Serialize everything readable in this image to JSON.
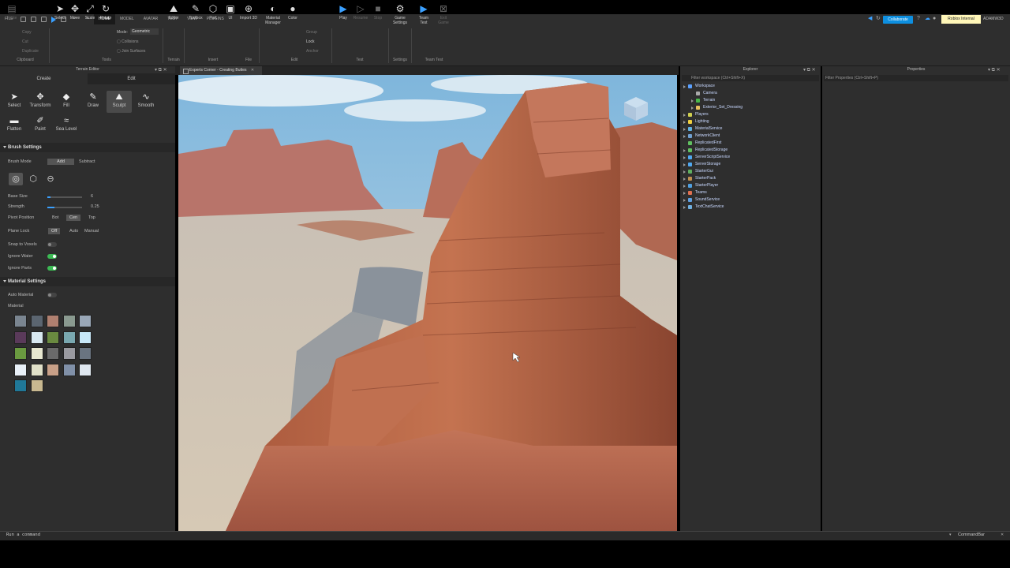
{
  "menubar": {
    "file": "FILE",
    "tabs": [
      "HOME",
      "MODEL",
      "AVATAR",
      "TEST",
      "VIEW",
      "PLUGINS"
    ],
    "active_tab": "HOME",
    "collaborate": "Collaborate",
    "roblox_internal": "Roblox Internal",
    "username": "ADAMW3D"
  },
  "ribbon": {
    "clipboard": {
      "paste": "Paste",
      "copy": "Copy",
      "cut": "Cut",
      "duplicate": "Duplicate",
      "group": "Clipboard"
    },
    "tools": {
      "select": "Select",
      "move": "Move",
      "scale": "Scale",
      "rotate": "Rotate",
      "mode_label": "Mode:",
      "mode_value": "Geometric",
      "collisions": "Collisions",
      "join_surfaces": "Join Surfaces",
      "group": "Tools"
    },
    "terrain": {
      "editor": "Editor",
      "group": "Terrain"
    },
    "insert": {
      "toolbox": "Toolbox",
      "part": "Part",
      "ui": "UI",
      "group": "Insert"
    },
    "file": {
      "import3d": "Import 3D",
      "group": "File"
    },
    "edit": {
      "material_manager": "Material Manager",
      "color": "Color",
      "group_btn": "Group",
      "lock": "Lock",
      "anchor": "Anchor",
      "group": "Edit"
    },
    "test": {
      "play": "Play",
      "resume": "Resume",
      "stop": "Stop",
      "group": "Test"
    },
    "settings": {
      "game_settings": "Game Settings",
      "group": "Settings"
    },
    "team_test": {
      "team_test": "Team Test",
      "exit_game": "Exit Game",
      "group": "Team Test"
    }
  },
  "terrain_editor": {
    "title": "Terrain Editor",
    "tabs": [
      "Create",
      "Edit"
    ],
    "tools": [
      {
        "label": "Select",
        "icon": "arrow-icon"
      },
      {
        "label": "Transform",
        "icon": "move-icon"
      },
      {
        "label": "Fill",
        "icon": "bucket-icon"
      },
      {
        "label": "Draw",
        "icon": "draw-icon"
      },
      {
        "label": "Sculpt",
        "icon": "sculpt-icon"
      },
      {
        "label": "Smooth",
        "icon": "smooth-icon"
      },
      {
        "label": "Flatten",
        "icon": "flatten-icon"
      },
      {
        "label": "Paint",
        "icon": "paint-icon"
      },
      {
        "label": "Sea Level",
        "icon": "sea-level-icon"
      }
    ],
    "selected_tool": "Sculpt",
    "brush_settings": {
      "title": "Brush Settings",
      "brush_mode": "Brush Mode",
      "add": "Add",
      "subtract": "Subtract",
      "base_size_label": "Base Size",
      "base_size_value": "6",
      "strength_label": "Strength",
      "strength_value": "0.25",
      "pivot_label": "Pivot Position",
      "pivot_options": [
        "Bot",
        "Cen",
        "Top"
      ],
      "plane_lock_label": "Plane Lock",
      "plane_lock_options": [
        "Off",
        "Auto",
        "Manual"
      ],
      "snap_label": "Snap to Voxels",
      "ignore_water_label": "Ignore Water",
      "ignore_parts_label": "Ignore Parts"
    },
    "material_settings": {
      "title": "Material Settings",
      "auto_material": "Auto Material",
      "material_label": "Material",
      "swatches": [
        "#7a8590",
        "#5b6570",
        "#b08070",
        "#8a9a90",
        "#9aa8b8",
        "#5a3a5a",
        "#d8e8f0",
        "#6a8a40",
        "#7aa8b0",
        "#c8e8f8",
        "#6a9a40",
        "#e8e8d0",
        "#6a6a6a",
        "#9a9aa0",
        "#6a7480",
        "#e8f0f8",
        "#e0e0c8",
        "#c8a088",
        "#8090a8",
        "#e0e8f0",
        "#207898",
        "#c8b890"
      ]
    }
  },
  "viewport": {
    "tab_title": "Experts Corner - Creating Buttes"
  },
  "explorer": {
    "title": "Explorer",
    "filter_placeholder": "Filter workspace (Ctrl+Shift+X)",
    "items": [
      {
        "label": "Workspace",
        "color": "#5aa0ff"
      },
      {
        "label": "Camera",
        "color": "#aaaaaa"
      },
      {
        "label": "Terrain",
        "color": "#4ab84a"
      },
      {
        "label": "Exterior_Set_Dressing",
        "color": "#e8c060"
      },
      {
        "label": "Players",
        "color": "#d0d050"
      },
      {
        "label": "Lighting",
        "color": "#f0d040"
      },
      {
        "label": "MaterialService",
        "color": "#60b0e0"
      },
      {
        "label": "NetworkClient",
        "color": "#70a0d0"
      },
      {
        "label": "ReplicatedFirst",
        "color": "#60c060"
      },
      {
        "label": "ReplicatedStorage",
        "color": "#60c060"
      },
      {
        "label": "ServerScriptService",
        "color": "#50a8f0"
      },
      {
        "label": "ServerStorage",
        "color": "#50a8f0"
      },
      {
        "label": "StarterGui",
        "color": "#60b060"
      },
      {
        "label": "StarterPack",
        "color": "#c09050"
      },
      {
        "label": "StarterPlayer",
        "color": "#50a0e0"
      },
      {
        "label": "Teams",
        "color": "#e07050"
      },
      {
        "label": "SoundService",
        "color": "#60a0e0"
      },
      {
        "label": "TextChatService",
        "color": "#70b0e0"
      }
    ]
  },
  "properties": {
    "title": "Properties",
    "filter_placeholder": "Filter Properties (Ctrl+Shift+P)"
  },
  "command_bar": {
    "placeholder": "Run a command",
    "label": "CommandBar"
  }
}
